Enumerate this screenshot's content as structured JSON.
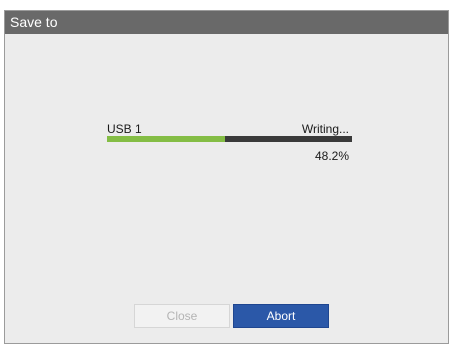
{
  "window": {
    "title": "Save to"
  },
  "progress": {
    "device": "USB 1",
    "status": "Writing...",
    "percent_text": "48.2%",
    "fraction": 0.482
  },
  "buttons": {
    "close_label": "Close",
    "close_enabled": false,
    "abort_label": "Abort"
  },
  "colors": {
    "titlebar": "#696969",
    "progress_fill": "#84bd45",
    "progress_track": "#3a3a3a",
    "abort_button": "#2b58a8"
  }
}
